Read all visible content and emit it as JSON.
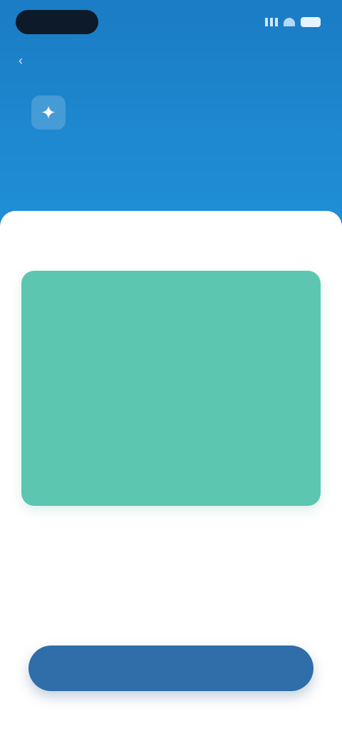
{
  "status_bar": {
    "time": "",
    "icons": [
      "signal-icon",
      "wifi-icon",
      "battery-icon"
    ]
  },
  "header": {
    "back_label": "",
    "hero_icon": "star-icon",
    "title": ""
  },
  "sheet": {
    "label": "",
    "card": {
      "lines": [
        "",
        "",
        "",
        "",
        "",
        ""
      ]
    },
    "footnote": ""
  },
  "actions": {
    "primary_label": ""
  },
  "colors": {
    "header": "#1e88d0",
    "card": "#5cc6b1",
    "button": "#2f6ea8"
  }
}
